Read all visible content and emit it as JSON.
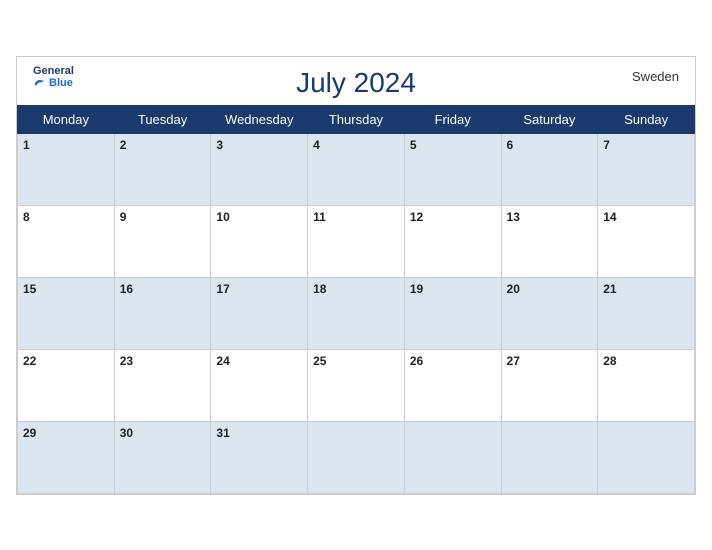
{
  "header": {
    "title": "July 2024",
    "country": "Sweden",
    "logo_general": "General",
    "logo_blue": "Blue"
  },
  "weekdays": [
    "Monday",
    "Tuesday",
    "Wednesday",
    "Thursday",
    "Friday",
    "Saturday",
    "Sunday"
  ],
  "weeks": [
    [
      1,
      2,
      3,
      4,
      5,
      6,
      7
    ],
    [
      8,
      9,
      10,
      11,
      12,
      13,
      14
    ],
    [
      15,
      16,
      17,
      18,
      19,
      20,
      21
    ],
    [
      22,
      23,
      24,
      25,
      26,
      27,
      28
    ],
    [
      29,
      30,
      31,
      null,
      null,
      null,
      null
    ]
  ]
}
